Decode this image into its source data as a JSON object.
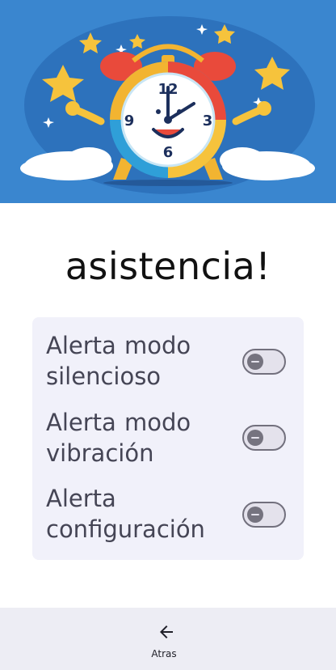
{
  "header": {
    "illustration": "alarm-clock-puzzle-illustration",
    "clock_numbers": [
      "12",
      "3",
      "6",
      "9"
    ]
  },
  "title": "asistencia!",
  "settings": {
    "items": [
      {
        "label": "Alerta modo silencioso",
        "enabled": false
      },
      {
        "label": "Alerta modo vibración",
        "enabled": false
      },
      {
        "label": "Alerta configuración",
        "enabled": false
      }
    ]
  },
  "bottom_nav": {
    "back_label": "Atras",
    "back_icon": "arrow-left-icon"
  },
  "colors": {
    "hero_background": "#3a86cf",
    "card_background": "#f1f1fa",
    "text_primary": "#111111",
    "text_secondary": "#454555",
    "toggle_off_track": "#e4e2ec",
    "toggle_off_outline": "#72707d",
    "bottom_bar": "#ededf4"
  }
}
